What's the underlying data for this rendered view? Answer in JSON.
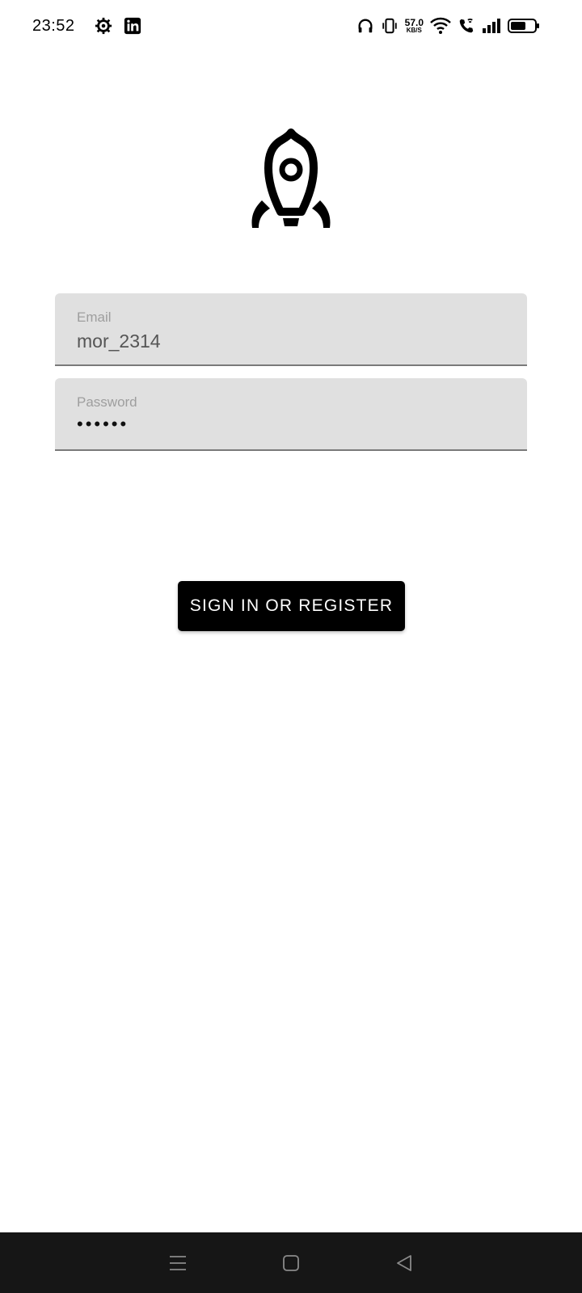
{
  "status_bar": {
    "time": "23:52",
    "net_speed_value": "57.0",
    "net_speed_unit": "KB/S",
    "icons_left": [
      "settings-icon",
      "linkedin-icon"
    ],
    "icons_right": [
      "headphones-icon",
      "vibrate-icon",
      "wifi-icon",
      "wifi-call-icon",
      "signal-icon",
      "battery-icon"
    ]
  },
  "logo": {
    "icon": "rocket-icon"
  },
  "form": {
    "email_label": "Email",
    "email_value": "mor_2314",
    "password_label": "Password",
    "password_masked": "••••••"
  },
  "submit_label": "SIGN IN OR REGISTER",
  "nav_bar": {
    "buttons": [
      "menu-icon",
      "home-icon",
      "back-icon"
    ]
  },
  "colors": {
    "background": "#ffffff",
    "field_bg": "#e0e0e0",
    "button_bg": "#000000",
    "nav_bg": "#161616"
  }
}
